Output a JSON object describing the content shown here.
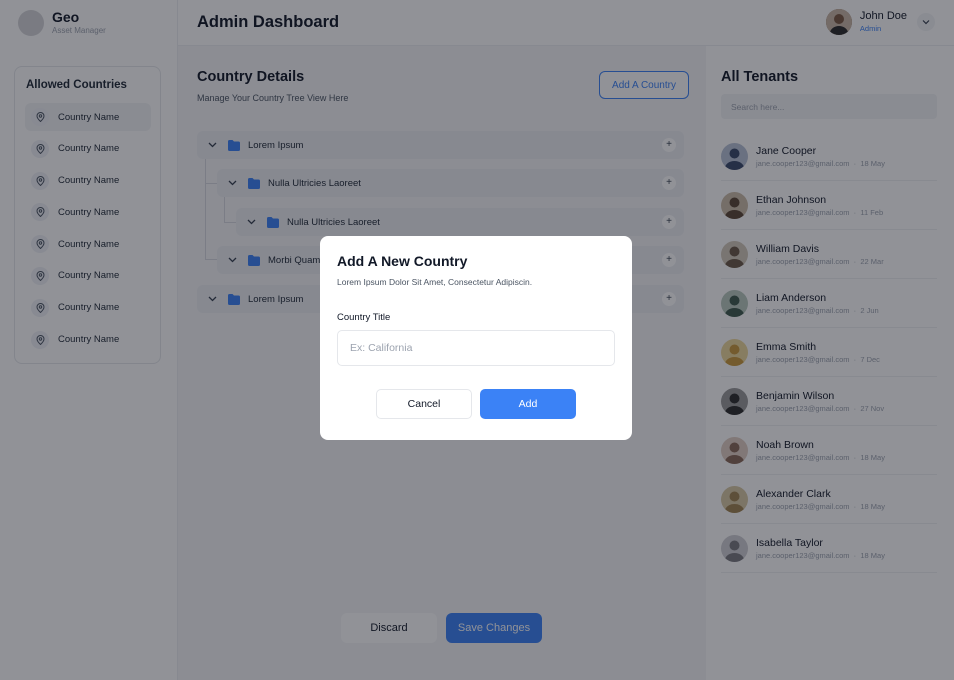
{
  "brand": {
    "name": "Geo",
    "subtitle": "Asset Manager"
  },
  "sidebar": {
    "title": "Allowed Countries",
    "items": [
      {
        "label": "Country Name"
      },
      {
        "label": "Country Name"
      },
      {
        "label": "Country Name"
      },
      {
        "label": "Country Name"
      },
      {
        "label": "Country Name"
      },
      {
        "label": "Country Name"
      },
      {
        "label": "Country Name"
      },
      {
        "label": "Country Name"
      }
    ]
  },
  "header": {
    "title": "Admin Dashboard",
    "user": {
      "name": "John Doe",
      "role": "Admin"
    }
  },
  "main": {
    "title": "Country Details",
    "subtitle": "Manage Your Country Tree View Here",
    "add_button": "Add A Country",
    "tree": [
      {
        "label": "Lorem Ipsum"
      },
      {
        "label": "Nulla Ultricies Laoreet"
      },
      {
        "label": "Nulla Ultricies Laoreet"
      },
      {
        "label": "Morbi Quam"
      },
      {
        "label": "Lorem Ipsum"
      }
    ],
    "plus_glyph": "+",
    "discard_label": "Discard",
    "save_label": "Save Changes"
  },
  "tenants": {
    "title": "All Tenants",
    "search_placeholder": "Search here...",
    "items": [
      {
        "name": "Jane Cooper",
        "email": "jane.cooper123@gmail.com",
        "date": "18 May",
        "avatar_color": "#3a4a6b"
      },
      {
        "name": "Ethan Johnson",
        "email": "jane.cooper123@gmail.com",
        "date": "11 Feb",
        "avatar_color": "#5b4636"
      },
      {
        "name": "William Davis",
        "email": "jane.cooper123@gmail.com",
        "date": "22 Mar",
        "avatar_color": "#6b5a48"
      },
      {
        "name": "Liam Anderson",
        "email": "jane.cooper123@gmail.com",
        "date": "2 Jun",
        "avatar_color": "#3f5b4e"
      },
      {
        "name": "Emma Smith",
        "email": "jane.cooper123@gmail.com",
        "date": "7 Dec",
        "avatar_color": "#c99a3e"
      },
      {
        "name": "Benjamin Wilson",
        "email": "jane.cooper123@gmail.com",
        "date": "27 Nov",
        "avatar_color": "#2e2e2e"
      },
      {
        "name": "Noah Brown",
        "email": "jane.cooper123@gmail.com",
        "date": "18 May",
        "avatar_color": "#8a6a5a"
      },
      {
        "name": "Alexander Clark",
        "email": "jane.cooper123@gmail.com",
        "date": "18 May",
        "avatar_color": "#a08452"
      },
      {
        "name": "Isabella Taylor",
        "email": "jane.cooper123@gmail.com",
        "date": "18 May",
        "avatar_color": "#7a7a80"
      }
    ]
  },
  "modal": {
    "title": "Add A New Country",
    "subtitle": "Lorem Ipsum Dolor Sit Amet, Consectetur Adipiscin.",
    "field_label": "Country Title",
    "field_placeholder": "Ex: California",
    "cancel_label": "Cancel",
    "add_label": "Add"
  },
  "colors": {
    "accent": "#3b82f6",
    "overlay": "rgba(15,18,28,0.46)",
    "tree_row": "#eceef3"
  }
}
